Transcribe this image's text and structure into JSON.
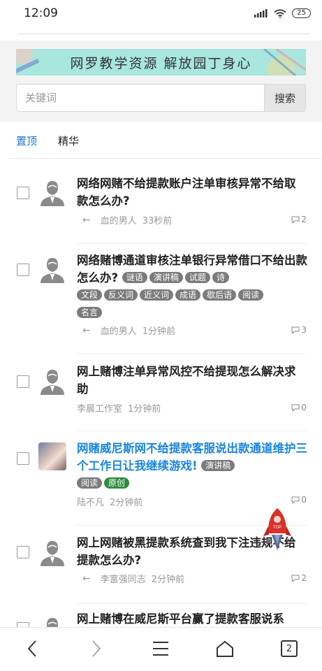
{
  "status_bar": {
    "time": "12:09",
    "battery": "25"
  },
  "banner": {
    "text": "网罗教学资源  解放园丁身心"
  },
  "search": {
    "placeholder": "关键词",
    "button_label": "搜索"
  },
  "tabs": [
    {
      "label": "置顶",
      "active": true
    },
    {
      "label": "精华",
      "active": false
    }
  ],
  "posts": [
    {
      "title": "网络网赌不给提款账户注单审核异常不给取款怎么办?",
      "tags": [],
      "author": "血的男人",
      "time": "33秒前",
      "comments": "2",
      "reply_arrow": true,
      "title_color": "#222222"
    },
    {
      "title": "网络赌博通道审核注单银行异常借口不给出款怎么办?",
      "tags": [
        "谜语",
        "演讲稿",
        "试题",
        "诗",
        "文段",
        "反义词",
        "近义词",
        "成语",
        "歇后语",
        "阅读",
        "名言"
      ],
      "author": "血的男人",
      "time": "1分钟前",
      "comments": "3",
      "reply_arrow": true,
      "title_color": "#222222"
    },
    {
      "title": "网上赌博注单异常风控不给提现怎么解决求助",
      "tags": [],
      "author": "李晨工作室",
      "time": "1分钟前",
      "comments": "0",
      "reply_arrow": false,
      "title_color": "#222222"
    },
    {
      "title": "网赌威尼斯网不给提款客服说出款通道维护三个工作日让我继续游戏!",
      "tags": [
        "演讲稿",
        "阅读",
        "原创"
      ],
      "author": "陆不凡",
      "time": "2分钟前",
      "comments": "0",
      "reply_arrow": false,
      "title_color": "#1a86e0"
    },
    {
      "title": "网上网赌被黑提款系统查到我下注违规不给提款怎么办?",
      "tags": [],
      "author": "李富强同志",
      "time": "2分钟前",
      "comments": "2",
      "reply_arrow": true,
      "title_color": "#222222"
    },
    {
      "title": "网上赌博在威尼斯平台赢了提款客服说系",
      "tags": [],
      "author": "",
      "time": "",
      "comments": "",
      "reply_arrow": false,
      "title_color": "#222222"
    }
  ],
  "back_to_top": {
    "label": "TOP"
  },
  "bottom_nav": {
    "tab_count": "2"
  },
  "colors": {
    "accent": "#1a76c9",
    "tag_gray": "#7b7b7b",
    "tag_green": "#2e8b3b",
    "banner_bg": "#a8e6de"
  }
}
